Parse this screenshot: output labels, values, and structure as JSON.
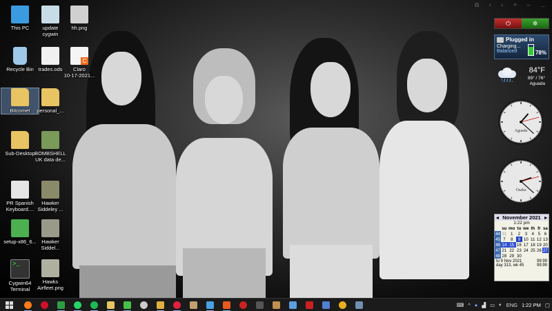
{
  "desktop_icons": [
    {
      "name": "this-pc",
      "label": "This PC",
      "icon": "computer-icon",
      "color": "#3b9be0"
    },
    {
      "name": "recycle-bin",
      "label": "Recycle Bin",
      "icon": "recycle-bin-icon",
      "color": "#9ec8e8"
    },
    {
      "name": "bitcomet",
      "label": "Bitcomet",
      "icon": "folder-user-icon",
      "color": "#e8c462"
    },
    {
      "name": "sub-desktop",
      "label": "Sub-Desktop",
      "icon": "folder-icon",
      "color": "#e8c462"
    },
    {
      "name": "pr-spanish-keyboard",
      "label": "PR Spanish\nKeyboard....",
      "icon": "keyboard-icon",
      "color": "#e6e6e6"
    },
    {
      "name": "setup-x86",
      "label": "setup-x86_6...",
      "icon": "installer-icon",
      "color": "#4caf50"
    },
    {
      "name": "cygwin64-terminal",
      "label": "Cygwin64\nTerminal",
      "icon": "terminal-icon",
      "color": "#333333"
    },
    {
      "name": "update-cygwin",
      "label": "update\ncygwin",
      "icon": "script-icon",
      "color": "#c8dce8"
    },
    {
      "name": "trades-ods",
      "label": "trades.ods",
      "icon": "spreadsheet-icon",
      "color": "#f0f0f0"
    },
    {
      "name": "personal",
      "label": "personal_...",
      "icon": "folder-icon",
      "color": "#e8c462"
    },
    {
      "name": "bombshell",
      "label": "BOMBSHELL\nUK data de...",
      "icon": "image-icon",
      "color": "#7a9a5a"
    },
    {
      "name": "hawker-siddeley-1",
      "label": "Hawker\nSiddeley ...",
      "icon": "aircraft-image-icon",
      "color": "#8a8a6a"
    },
    {
      "name": "hawker-siddeley-2",
      "label": "Hawker\nSiddel...",
      "icon": "aircraft-image-icon",
      "color": "#9a9a8a"
    },
    {
      "name": "hh-png",
      "label": "hh.png",
      "icon": "image-icon",
      "color": "#d0d0d0"
    },
    {
      "name": "claro",
      "label": "Claro\n10-17-2021...",
      "icon": "pdf-icon",
      "color": "#f5f5f5"
    },
    {
      "name": "hawks-airfleet",
      "label": "Hawks\nAirfleet.png",
      "icon": "aircraft-image-icon",
      "color": "#b0b0a0"
    }
  ],
  "battery_gadget": {
    "title": "Plugged in",
    "status": "Charging...",
    "plan": "Balanced",
    "percent": "78%"
  },
  "weather_gadget": {
    "temp": "84°F",
    "range": "89° / 76°",
    "location": "Aguada"
  },
  "clocks": [
    {
      "city": "Aguada"
    },
    {
      "city": "Osaka"
    }
  ],
  "calendar": {
    "month": "November 2021",
    "time": "1:22 pm",
    "weekday_headers": [
      "su",
      "mo",
      "tu",
      "we",
      "th",
      "fr",
      "sa"
    ],
    "weeks": [
      {
        "wk": "44",
        "days": [
          "31",
          "1",
          "2",
          "3",
          "4",
          "5",
          "6"
        ]
      },
      {
        "wk": "45",
        "days": [
          "7",
          "8",
          "9",
          "10",
          "11",
          "12",
          "13"
        ]
      },
      {
        "wk": "46",
        "days": [
          "14",
          "15",
          "16",
          "17",
          "18",
          "19",
          "20"
        ]
      },
      {
        "wk": "47",
        "days": [
          "21",
          "22",
          "23",
          "24",
          "25",
          "26",
          "27"
        ]
      },
      {
        "wk": "48",
        "days": [
          "28",
          "29",
          "30",
          "",
          "",
          "",
          ""
        ]
      }
    ],
    "footer_left1": "tu 9 Nov 2021",
    "footer_left2": "day 313, wk 45",
    "footer_right1": "99:99",
    "footer_right2": "99:99"
  },
  "taskbar": {
    "apps": [
      {
        "name": "firefox",
        "icon": "firefox-icon",
        "color": "#ff7a1a",
        "run": true
      },
      {
        "name": "opera",
        "icon": "opera-icon",
        "color": "#d0102a",
        "run": false
      },
      {
        "name": "spreadsheet-app",
        "icon": "spreadsheet-icon",
        "color": "#2e9e44",
        "run": true
      },
      {
        "name": "whatsapp",
        "icon": "whatsapp-icon",
        "color": "#25d366",
        "run": true
      },
      {
        "name": "spotify",
        "icon": "spotify-icon",
        "color": "#1db954",
        "run": true
      },
      {
        "name": "file-manager",
        "icon": "folder-icon",
        "color": "#e8c462",
        "run": true
      },
      {
        "name": "wechat",
        "icon": "chat-icon",
        "color": "#48c048",
        "run": true
      },
      {
        "name": "stopwatch",
        "icon": "stopwatch-icon",
        "color": "#cccccc",
        "run": false
      },
      {
        "name": "explorer",
        "icon": "folder-icon",
        "color": "#e0b040",
        "run": true
      },
      {
        "name": "opera-gx",
        "icon": "opera-icon",
        "color": "#e02040",
        "run": true
      },
      {
        "name": "file-app",
        "icon": "document-icon",
        "color": "#c0a070",
        "run": false
      },
      {
        "name": "remote-desktop",
        "icon": "monitor-icon",
        "color": "#4aa0e0",
        "run": true
      },
      {
        "name": "office",
        "icon": "office-icon",
        "color": "#e85a20",
        "run": true
      },
      {
        "name": "media-app",
        "icon": "media-icon",
        "color": "#cc2222",
        "run": false
      },
      {
        "name": "terminal-app",
        "icon": "terminal-icon",
        "color": "#555555",
        "run": false
      },
      {
        "name": "word-app",
        "icon": "document-icon",
        "color": "#c09050",
        "run": false
      },
      {
        "name": "notes-app",
        "icon": "notes-icon",
        "color": "#5aa0e0",
        "run": false
      },
      {
        "name": "game-app",
        "icon": "game-icon",
        "color": "#cc2020",
        "run": false
      },
      {
        "name": "editor-app",
        "icon": "editor-icon",
        "color": "#5080d0",
        "run": false
      },
      {
        "name": "chrome",
        "icon": "chrome-icon",
        "color": "#e8b020",
        "run": false
      },
      {
        "name": "gallery-app",
        "icon": "image-icon",
        "color": "#7090b0",
        "run": false
      }
    ],
    "lang": "ENG",
    "time": "1:22 PM"
  }
}
